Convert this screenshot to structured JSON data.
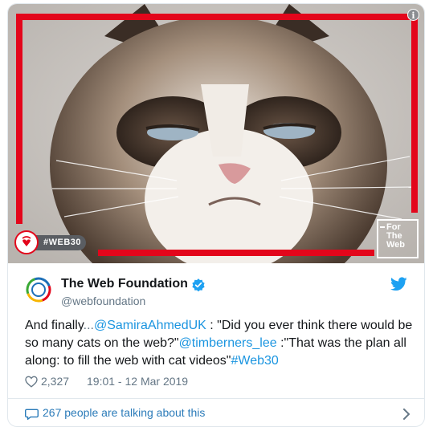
{
  "media": {
    "hashtag_badge": "#WEB30",
    "ftw_lines": [
      "For",
      "The",
      "Web"
    ],
    "info_glyph": "i",
    "colors": {
      "frame_red": "#e3061b"
    }
  },
  "author": {
    "name": "The Web Foundation",
    "handle": "@webfoundation",
    "verified": true,
    "avatar_icon": "web-foundation-logo-icon"
  },
  "tweet": {
    "intro": "And finally",
    "ellipsis": "...",
    "mention1": "@SamiraAhmedUK",
    "quote1": " : \"Did you ever think there would be so many cats on the web?\"",
    "mention2": "@timberners_lee",
    "quote2": " :\"That was the plan all along: to fill the web with cat videos\"",
    "hashtag": "#Web30"
  },
  "meta": {
    "like_count": "2,327",
    "timestamp": "19:01 - 12 Mar 2019"
  },
  "conversation": {
    "label": "267 people are talking about this"
  },
  "colors": {
    "link": "#1b95e0",
    "secondary_text": "#657786",
    "twitter_blue": "#1da1f2"
  }
}
